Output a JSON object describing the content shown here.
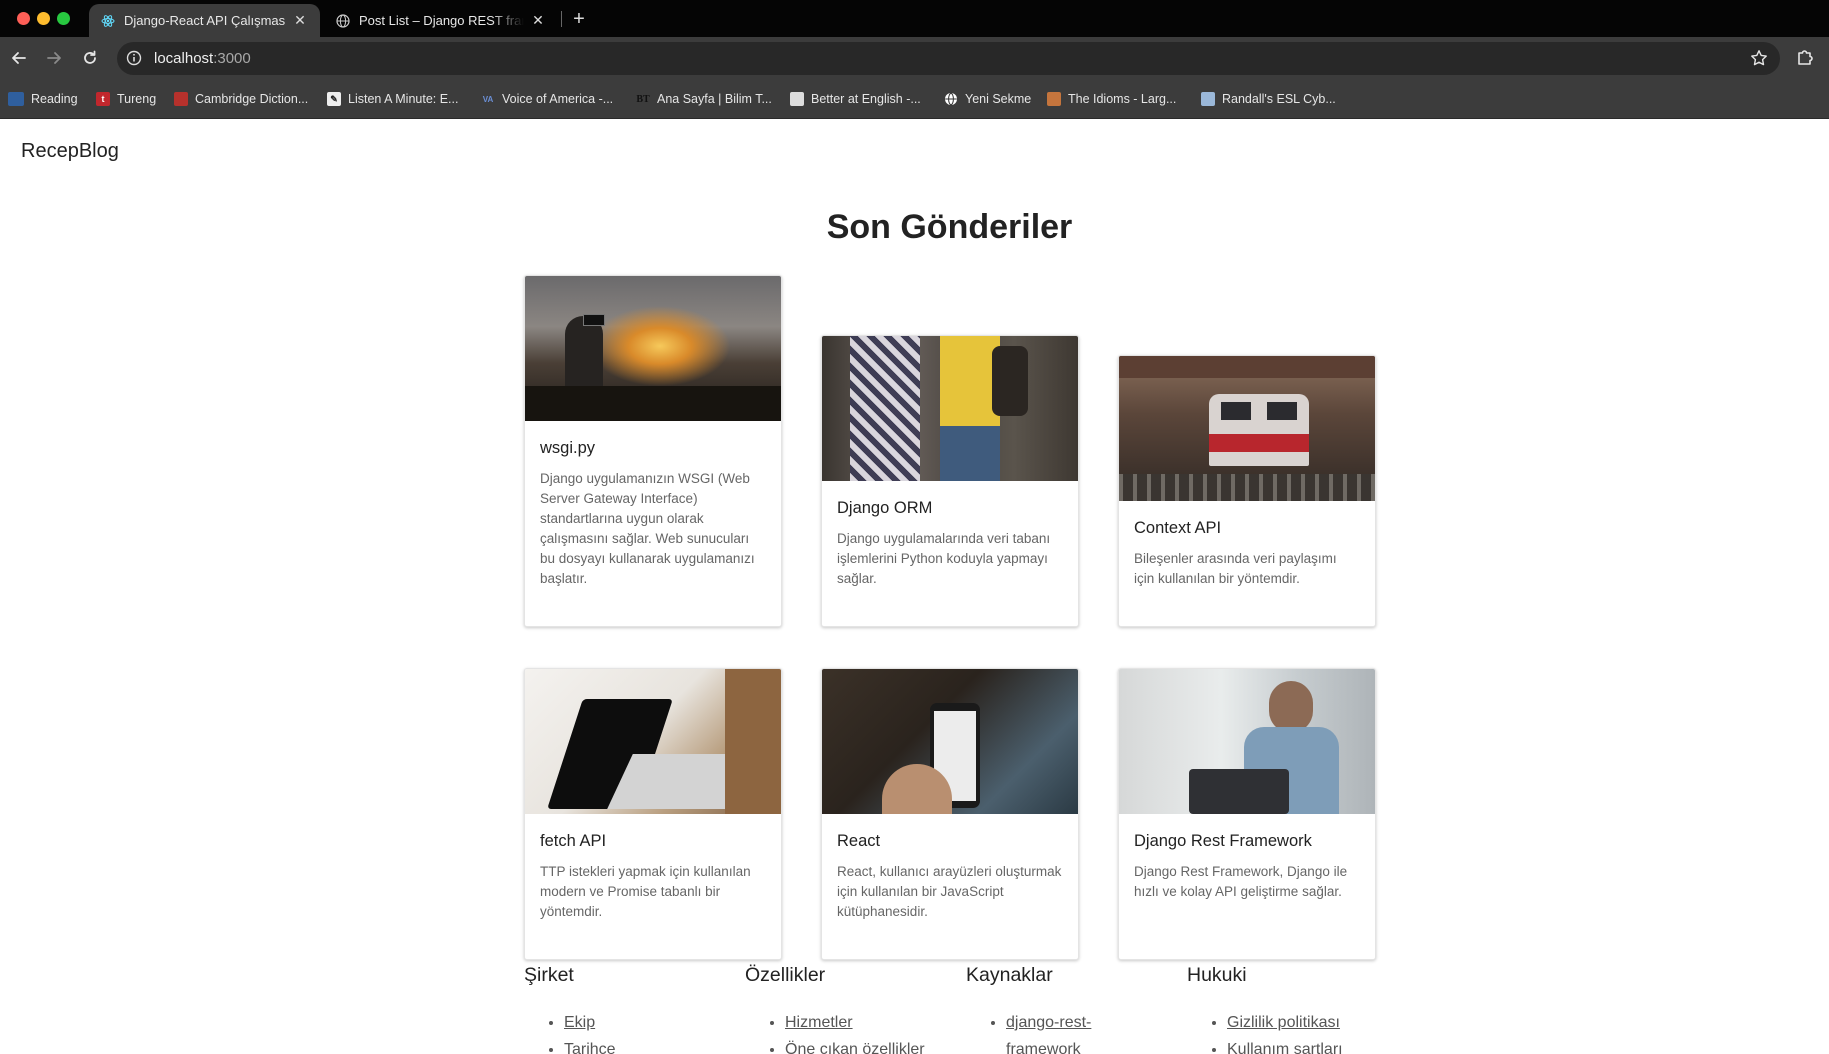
{
  "browser": {
    "tabs": [
      {
        "title": "Django-React API Çalışması",
        "active": true
      },
      {
        "title": "Post List – Django REST framework",
        "active": false
      }
    ],
    "address": {
      "host": "localhost",
      "port": ":3000"
    },
    "bookmarks": [
      {
        "label": "Reading",
        "icon": "reading-icon"
      },
      {
        "label": "Tureng",
        "icon": "tureng-icon"
      },
      {
        "label": "Cambridge Diction...",
        "icon": "cambridge-icon"
      },
      {
        "label": "Listen A Minute: E...",
        "icon": "listen-icon"
      },
      {
        "label": "Voice of America -...",
        "icon": "voa-icon"
      },
      {
        "label": "Ana Sayfa | Bilim T...",
        "icon": "bilim-icon"
      },
      {
        "label": "Better at English -...",
        "icon": "better-english-icon"
      },
      {
        "label": "Yeni Sekme",
        "icon": "globe-icon"
      },
      {
        "label": "The Idioms - Larg...",
        "icon": "idioms-icon"
      },
      {
        "label": "Randall's ESL Cyb...",
        "icon": "randalls-icon"
      }
    ]
  },
  "site": {
    "brand": "RecepBlog",
    "heading": "Son Gönderiler"
  },
  "posts": [
    {
      "title": "wsgi.py",
      "description": "Django uygulamanızın WSGI (Web Server Gateway Interface) standartlarına uygun olarak çalışmasını sağlar. Web sunucuları bu dosyayı kullanarak uygulamanızı başlatır.",
      "image": "fountain-photo"
    },
    {
      "title": "Django ORM",
      "description": "Django uygulamalarında veri tabanı işlemlerini Python koduyla yapmayı sağlar.",
      "image": "people-talking-photo"
    },
    {
      "title": "Context API",
      "description": "Bileşenler arasında veri paylaşımı için kullanılan bir yöntemdir.",
      "image": "train-photo"
    },
    {
      "title": "fetch API",
      "description": "TTP istekleri yapmak için kullanılan modern ve Promise tabanlı bir yöntemdir.",
      "image": "laptop-photo"
    },
    {
      "title": "React",
      "description": "React, kullanıcı arayüzleri oluşturmak için kullanılan bir JavaScript kütüphanesidir.",
      "image": "phone-photo"
    },
    {
      "title": "Django Rest Framework",
      "description": "Django Rest Framework, Django ile hızlı ve kolay API geliştirme sağlar.",
      "image": "man-phone-photo"
    }
  ],
  "footer": [
    {
      "title": "Şirket",
      "links": [
        "Ekip",
        "Tarihçe"
      ]
    },
    {
      "title": "Özellikler",
      "links": [
        "Hizmetler",
        "Öne çıkan özellikler"
      ]
    },
    {
      "title": "Kaynaklar",
      "links": [
        "django-rest-framework"
      ]
    },
    {
      "title": "Hukuki",
      "links": [
        "Gizlilik politikası",
        "Kullanım şartları"
      ]
    }
  ]
}
